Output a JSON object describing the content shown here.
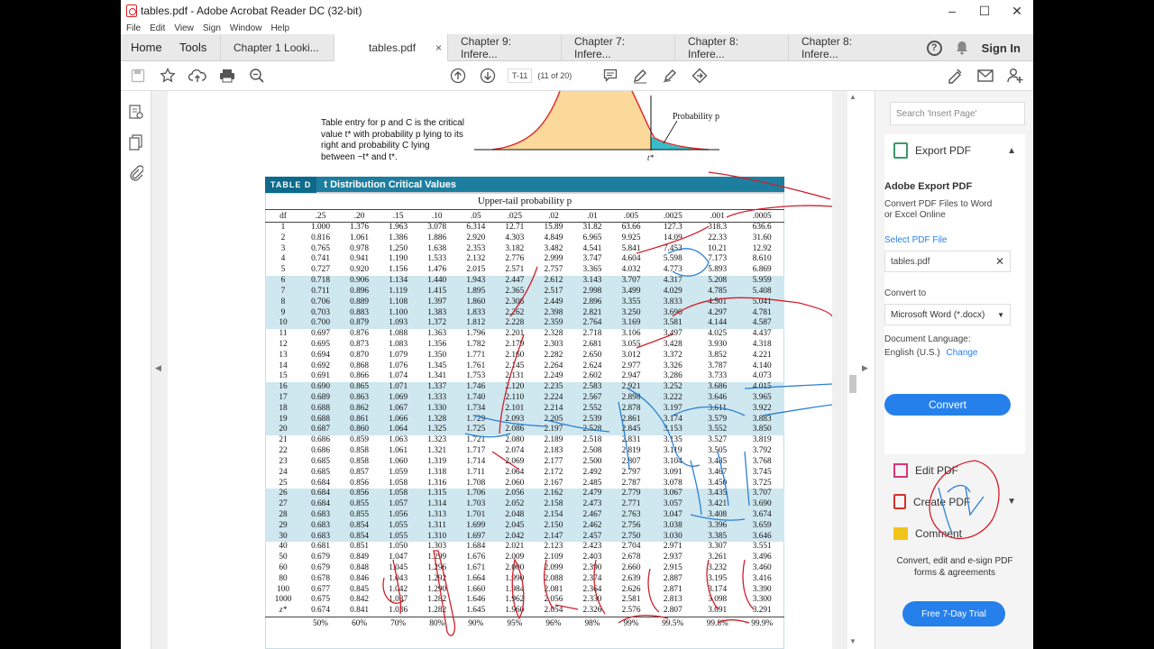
{
  "window": {
    "title": "tables.pdf - Adobe Acrobat Reader DC (32-bit)",
    "controls": [
      "–",
      "☐",
      "✕"
    ]
  },
  "menu": [
    "File",
    "Edit",
    "View",
    "Sign",
    "Window",
    "Help"
  ],
  "tabs": {
    "home": "Home",
    "tools": "Tools",
    "docs": [
      {
        "label": "Chapter 1 Looki...",
        "active": false
      },
      {
        "label": "tables.pdf",
        "active": true,
        "close": "×"
      },
      {
        "label": "Chapter 9: Infere...",
        "active": false
      },
      {
        "label": "Chapter 7: Infere...",
        "active": false
      },
      {
        "label": "Chapter 8: Infere...",
        "active": false
      },
      {
        "label": "Chapter 8: Infere...",
        "active": false
      }
    ],
    "help": "?",
    "signin": "Sign In"
  },
  "toolbar": {
    "page_label": "T-11",
    "page_count": "(11 of 20)"
  },
  "page": {
    "entry_text": "Table entry for p and C is the critical value t* with probability p lying to its right and probability C lying between −t* and t*.",
    "curve_label": "Probability p",
    "tstar": "t*",
    "table_tag": "TABLE D",
    "table_title": "t Distribution Critical Values",
    "upper_tail": "Upper-tail probability p",
    "df_header": "df",
    "p_headers": [
      ".25",
      ".20",
      ".15",
      ".10",
      ".05",
      ".025",
      ".02",
      ".01",
      ".005",
      ".0025",
      ".001",
      ".0005"
    ],
    "rows": [
      [
        "1",
        "1.000",
        "1.376",
        "1.963",
        "3.078",
        "6.314",
        "12.71",
        "15.89",
        "31.82",
        "63.66",
        "127.3",
        "318.3",
        "636.6"
      ],
      [
        "2",
        "0.816",
        "1.061",
        "1.386",
        "1.886",
        "2.920",
        "4.303",
        "4.849",
        "6.965",
        "9.925",
        "14.09",
        "22.33",
        "31.60"
      ],
      [
        "3",
        "0.765",
        "0.978",
        "1.250",
        "1.638",
        "2.353",
        "3.182",
        "3.482",
        "4.541",
        "5.841",
        "7.453",
        "10.21",
        "12.92"
      ],
      [
        "4",
        "0.741",
        "0.941",
        "1.190",
        "1.533",
        "2.132",
        "2.776",
        "2.999",
        "3.747",
        "4.604",
        "5.598",
        "7.173",
        "8.610"
      ],
      [
        "5",
        "0.727",
        "0.920",
        "1.156",
        "1.476",
        "2.015",
        "2.571",
        "2.757",
        "3.365",
        "4.032",
        "4.773",
        "5.893",
        "6.869"
      ],
      [
        "6",
        "0.718",
        "0.906",
        "1.134",
        "1.440",
        "1.943",
        "2.447",
        "2.612",
        "3.143",
        "3.707",
        "4.317",
        "5.208",
        "5.959"
      ],
      [
        "7",
        "0.711",
        "0.896",
        "1.119",
        "1.415",
        "1.895",
        "2.365",
        "2.517",
        "2.998",
        "3.499",
        "4.029",
        "4.785",
        "5.408"
      ],
      [
        "8",
        "0.706",
        "0.889",
        "1.108",
        "1.397",
        "1.860",
        "2.306",
        "2.449",
        "2.896",
        "3.355",
        "3.833",
        "4.501",
        "5.041"
      ],
      [
        "9",
        "0.703",
        "0.883",
        "1.100",
        "1.383",
        "1.833",
        "2.262",
        "2.398",
        "2.821",
        "3.250",
        "3.690",
        "4.297",
        "4.781"
      ],
      [
        "10",
        "0.700",
        "0.879",
        "1.093",
        "1.372",
        "1.812",
        "2.228",
        "2.359",
        "2.764",
        "3.169",
        "3.581",
        "4.144",
        "4.587"
      ],
      [
        "11",
        "0.697",
        "0.876",
        "1.088",
        "1.363",
        "1.796",
        "2.201",
        "2.328",
        "2.718",
        "3.106",
        "3.497",
        "4.025",
        "4.437"
      ],
      [
        "12",
        "0.695",
        "0.873",
        "1.083",
        "1.356",
        "1.782",
        "2.179",
        "2.303",
        "2.681",
        "3.055",
        "3.428",
        "3.930",
        "4.318"
      ],
      [
        "13",
        "0.694",
        "0.870",
        "1.079",
        "1.350",
        "1.771",
        "2.160",
        "2.282",
        "2.650",
        "3.012",
        "3.372",
        "3.852",
        "4.221"
      ],
      [
        "14",
        "0.692",
        "0.868",
        "1.076",
        "1.345",
        "1.761",
        "2.145",
        "2.264",
        "2.624",
        "2.977",
        "3.326",
        "3.787",
        "4.140"
      ],
      [
        "15",
        "0.691",
        "0.866",
        "1.074",
        "1.341",
        "1.753",
        "2.131",
        "2.249",
        "2.602",
        "2.947",
        "3.286",
        "3.733",
        "4.073"
      ],
      [
        "16",
        "0.690",
        "0.865",
        "1.071",
        "1.337",
        "1.746",
        "2.120",
        "2.235",
        "2.583",
        "2.921",
        "3.252",
        "3.686",
        "4.015"
      ],
      [
        "17",
        "0.689",
        "0.863",
        "1.069",
        "1.333",
        "1.740",
        "2.110",
        "2.224",
        "2.567",
        "2.898",
        "3.222",
        "3.646",
        "3.965"
      ],
      [
        "18",
        "0.688",
        "0.862",
        "1.067",
        "1.330",
        "1.734",
        "2.101",
        "2.214",
        "2.552",
        "2.878",
        "3.197",
        "3.611",
        "3.922"
      ],
      [
        "19",
        "0.688",
        "0.861",
        "1.066",
        "1.328",
        "1.729",
        "2.093",
        "2.205",
        "2.539",
        "2.861",
        "3.174",
        "3.579",
        "3.883"
      ],
      [
        "20",
        "0.687",
        "0.860",
        "1.064",
        "1.325",
        "1.725",
        "2.086",
        "2.197",
        "2.528",
        "2.845",
        "3.153",
        "3.552",
        "3.850"
      ],
      [
        "21",
        "0.686",
        "0.859",
        "1.063",
        "1.323",
        "1.721",
        "2.080",
        "2.189",
        "2.518",
        "2.831",
        "3.135",
        "3.527",
        "3.819"
      ],
      [
        "22",
        "0.686",
        "0.858",
        "1.061",
        "1.321",
        "1.717",
        "2.074",
        "2.183",
        "2.508",
        "2.819",
        "3.119",
        "3.505",
        "3.792"
      ],
      [
        "23",
        "0.685",
        "0.858",
        "1.060",
        "1.319",
        "1.714",
        "2.069",
        "2.177",
        "2.500",
        "2.807",
        "3.104",
        "3.485",
        "3.768"
      ],
      [
        "24",
        "0.685",
        "0.857",
        "1.059",
        "1.318",
        "1.711",
        "2.064",
        "2.172",
        "2.492",
        "2.797",
        "3.091",
        "3.467",
        "3.745"
      ],
      [
        "25",
        "0.684",
        "0.856",
        "1.058",
        "1.316",
        "1.708",
        "2.060",
        "2.167",
        "2.485",
        "2.787",
        "3.078",
        "3.450",
        "3.725"
      ],
      [
        "26",
        "0.684",
        "0.856",
        "1.058",
        "1.315",
        "1.706",
        "2.056",
        "2.162",
        "2.479",
        "2.779",
        "3.067",
        "3.435",
        "3.707"
      ],
      [
        "27",
        "0.684",
        "0.855",
        "1.057",
        "1.314",
        "1.703",
        "2.052",
        "2.158",
        "2.473",
        "2.771",
        "3.057",
        "3.421",
        "3.690"
      ],
      [
        "28",
        "0.683",
        "0.855",
        "1.056",
        "1.313",
        "1.701",
        "2.048",
        "2.154",
        "2.467",
        "2.763",
        "3.047",
        "3.408",
        "3.674"
      ],
      [
        "29",
        "0.683",
        "0.854",
        "1.055",
        "1.311",
        "1.699",
        "2.045",
        "2.150",
        "2.462",
        "2.756",
        "3.038",
        "3.396",
        "3.659"
      ],
      [
        "30",
        "0.683",
        "0.854",
        "1.055",
        "1.310",
        "1.697",
        "2.042",
        "2.147",
        "2.457",
        "2.750",
        "3.030",
        "3.385",
        "3.646"
      ],
      [
        "40",
        "0.681",
        "0.851",
        "1.050",
        "1.303",
        "1.684",
        "2.021",
        "2.123",
        "2.423",
        "2.704",
        "2.971",
        "3.307",
        "3.551"
      ],
      [
        "50",
        "0.679",
        "0.849",
        "1.047",
        "1.299",
        "1.676",
        "2.009",
        "2.109",
        "2.403",
        "2.678",
        "2.937",
        "3.261",
        "3.496"
      ],
      [
        "60",
        "0.679",
        "0.848",
        "1.045",
        "1.296",
        "1.671",
        "2.000",
        "2.099",
        "2.390",
        "2.660",
        "2.915",
        "3.232",
        "3.460"
      ],
      [
        "80",
        "0.678",
        "0.846",
        "1.043",
        "1.292",
        "1.664",
        "1.990",
        "2.088",
        "2.374",
        "2.639",
        "2.887",
        "3.195",
        "3.416"
      ],
      [
        "100",
        "0.677",
        "0.845",
        "1.042",
        "1.290",
        "1.660",
        "1.984",
        "2.081",
        "2.364",
        "2.626",
        "2.871",
        "3.174",
        "3.390"
      ],
      [
        "1000",
        "0.675",
        "0.842",
        "1.037",
        "1.282",
        "1.646",
        "1.962",
        "2.056",
        "2.330",
        "2.581",
        "2.813",
        "3.098",
        "3.300"
      ],
      [
        "z*",
        "0.674",
        "0.841",
        "1.036",
        "1.282",
        "1.645",
        "1.960",
        "2.054",
        "2.326",
        "2.576",
        "2.807",
        "3.091",
        "3.291"
      ]
    ],
    "conf_levels": [
      "50%",
      "60%",
      "70%",
      "80%",
      "90%",
      "95%",
      "96%",
      "98%",
      "99%",
      "99.5%",
      "99.8%",
      "99.9%"
    ]
  },
  "right_pane": {
    "search_placeholder": "Search 'Insert Page'",
    "export_title": "Export PDF",
    "export_heading": "Adobe Export PDF",
    "export_desc": "Convert PDF Files to Word or Excel Online",
    "select_file_label": "Select PDF File",
    "file_name": "tables.pdf",
    "convert_to_label": "Convert to",
    "convert_to_value": "Microsoft Word (*.docx)",
    "doc_language_label": "Document Language:",
    "doc_language_value": "English (U.S.)",
    "change_link": "Change",
    "convert_button": "Convert",
    "tools": [
      "Edit PDF",
      "Create PDF",
      "Comment"
    ],
    "promo": "Convert, edit and e-sign PDF forms & agreements",
    "trial_button": "Free 7-Day Trial"
  },
  "colors": {
    "accent": "#2680eb",
    "table_header": "#1d7ea0",
    "row_shade": "#cfe7ef",
    "ink_red": "#d0202a",
    "ink_blue": "#2a7fd4"
  }
}
